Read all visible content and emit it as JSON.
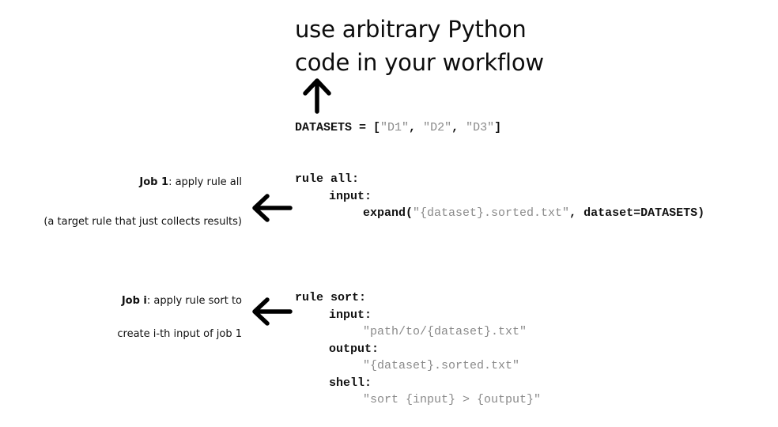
{
  "headline": {
    "line1": "use arbitrary Python",
    "line2": "code in your workflow"
  },
  "datasets_line": {
    "name": "DATASETS = [",
    "items": [
      "\"D1\"",
      "\"D2\"",
      "\"D3\""
    ],
    "sep": ", ",
    "close": "]"
  },
  "rule_all": {
    "header": "rule all:",
    "input_label": "input:",
    "expand_open": "expand(",
    "expand_pattern": "\"{dataset}.sorted.txt\"",
    "expand_rest": ", dataset=DATASETS)"
  },
  "rule_sort": {
    "header": "rule sort:",
    "input_label": "input:",
    "input_value": "\"path/to/{dataset}.txt\"",
    "output_label": "output:",
    "output_value": "\"{dataset}.sorted.txt\"",
    "shell_label": "shell:",
    "shell_value": "\"sort {input} > {output}\""
  },
  "job1": {
    "bold": "Job 1",
    "text": ": apply rule all",
    "note": "(a target rule that just collects results)"
  },
  "jobi": {
    "bold": "Job i",
    "text": ": apply rule sort to",
    "note": "create i-th input of job 1"
  },
  "icons": {
    "up": "arrow-up-icon",
    "left": "arrow-left-icon"
  }
}
